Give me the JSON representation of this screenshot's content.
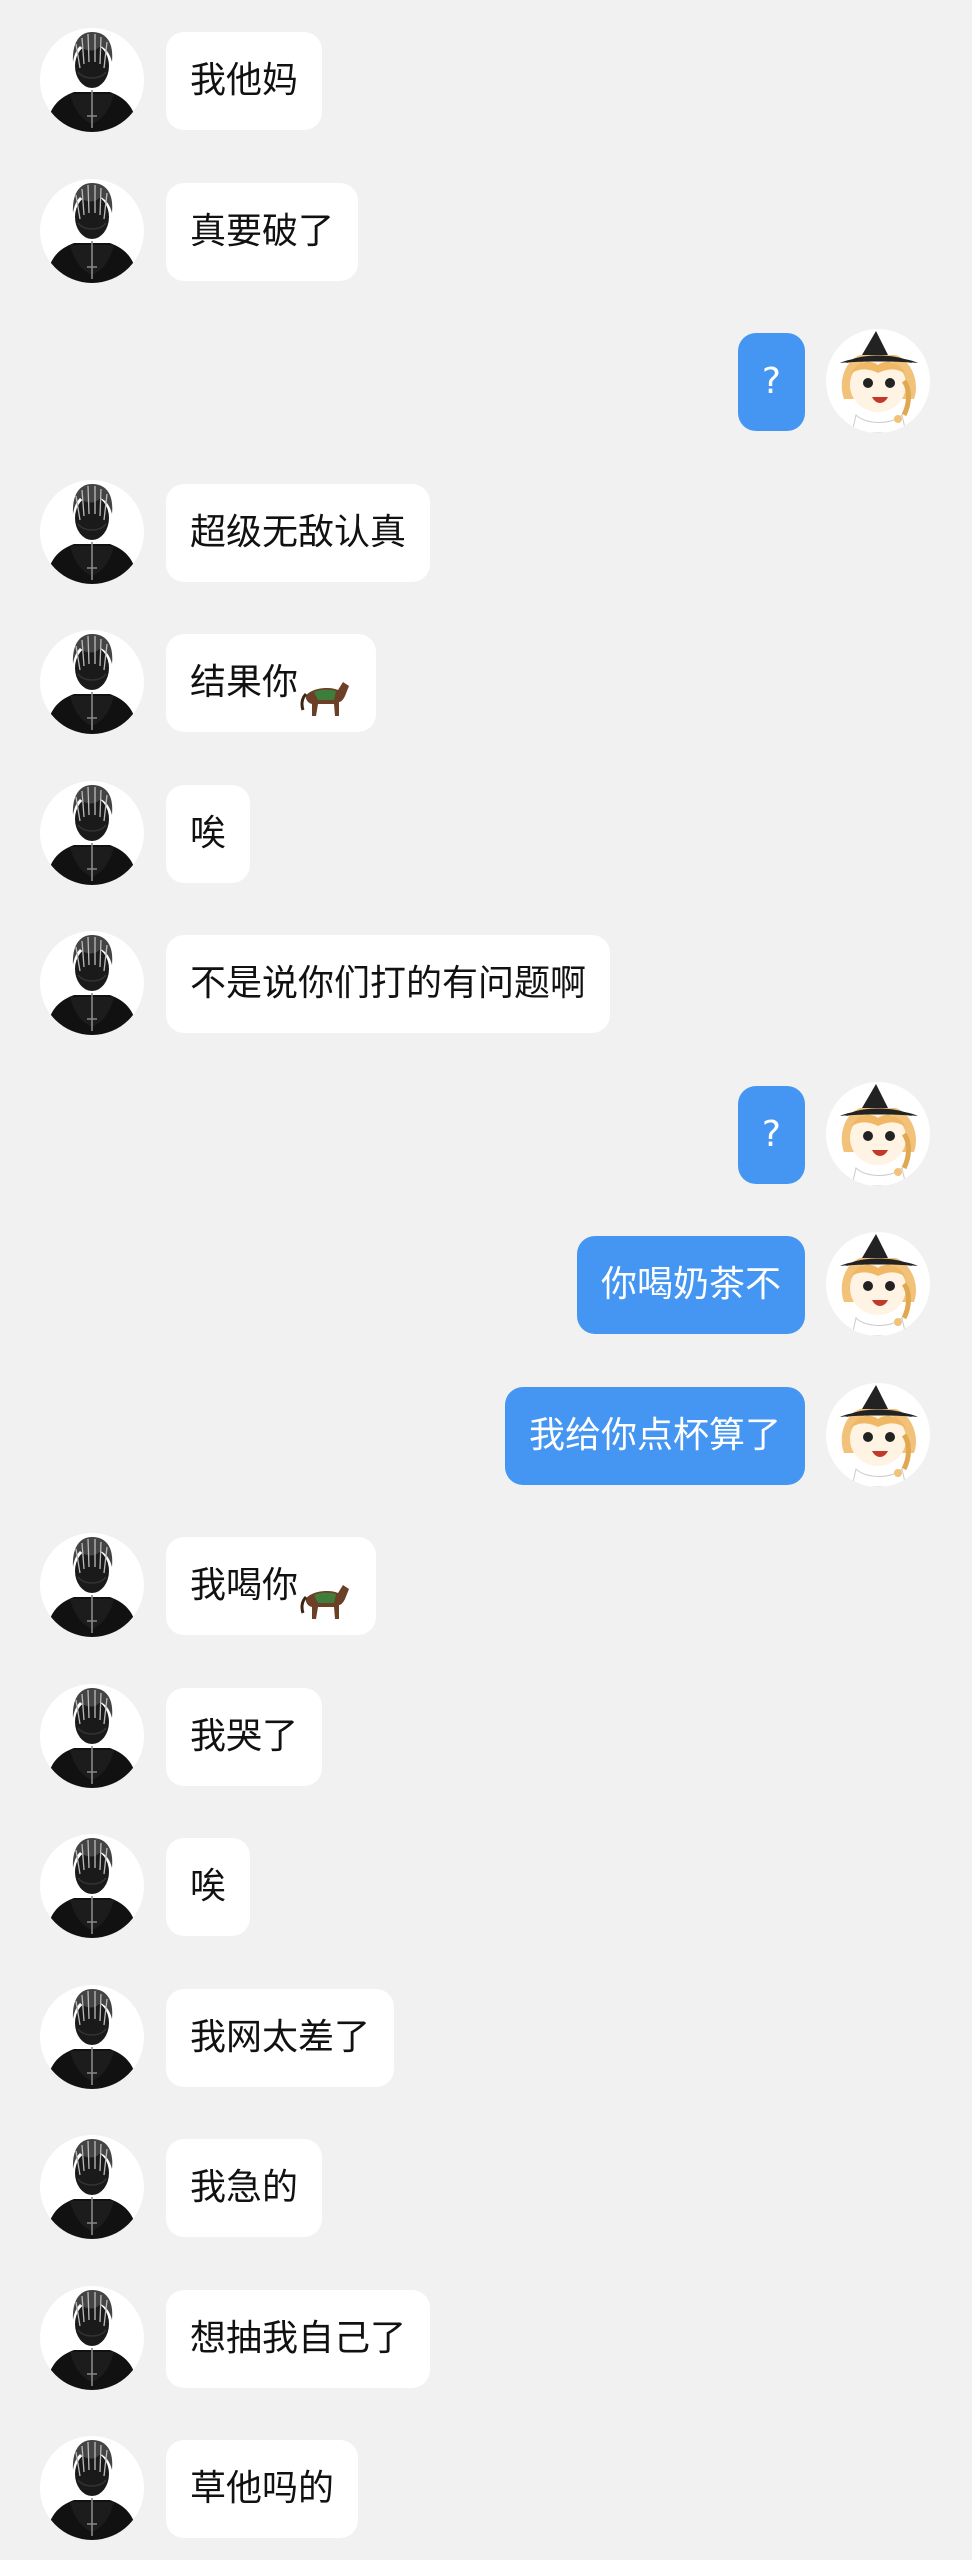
{
  "colors": {
    "background": "#f1f1f1",
    "incoming_bubble": "#ffffff",
    "outgoing_bubble": "#4596f2",
    "incoming_text": "#111111",
    "outgoing_text": "#ffffff"
  },
  "messages": [
    {
      "side": "left",
      "text": "我他妈",
      "emoji": ""
    },
    {
      "side": "left",
      "text": "真要破了",
      "emoji": ""
    },
    {
      "side": "right",
      "text": "?",
      "emoji": ""
    },
    {
      "side": "left",
      "text": "超级无敌认真",
      "emoji": ""
    },
    {
      "side": "left",
      "text": "结果你",
      "emoji": "horse-emoji"
    },
    {
      "side": "left",
      "text": "唉",
      "emoji": ""
    },
    {
      "side": "left",
      "text": "不是说你们打的有问题啊",
      "emoji": ""
    },
    {
      "side": "right",
      "text": "?",
      "emoji": ""
    },
    {
      "side": "right",
      "text": "你喝奶茶不",
      "emoji": ""
    },
    {
      "side": "right",
      "text": "我给你点杯算了",
      "emoji": ""
    },
    {
      "side": "left",
      "text": "我喝你",
      "emoji": "horse-emoji"
    },
    {
      "side": "left",
      "text": "我哭了",
      "emoji": ""
    },
    {
      "side": "left",
      "text": "唉",
      "emoji": ""
    },
    {
      "side": "left",
      "text": "我网太差了",
      "emoji": ""
    },
    {
      "side": "left",
      "text": "我急的",
      "emoji": ""
    },
    {
      "side": "left",
      "text": "想抽我自己了",
      "emoji": ""
    },
    {
      "side": "left",
      "text": "草他吗的",
      "emoji": ""
    }
  ],
  "avatars": {
    "left": "dark-figure-avatar-icon",
    "right": "anime-girl-avatar-icon"
  }
}
